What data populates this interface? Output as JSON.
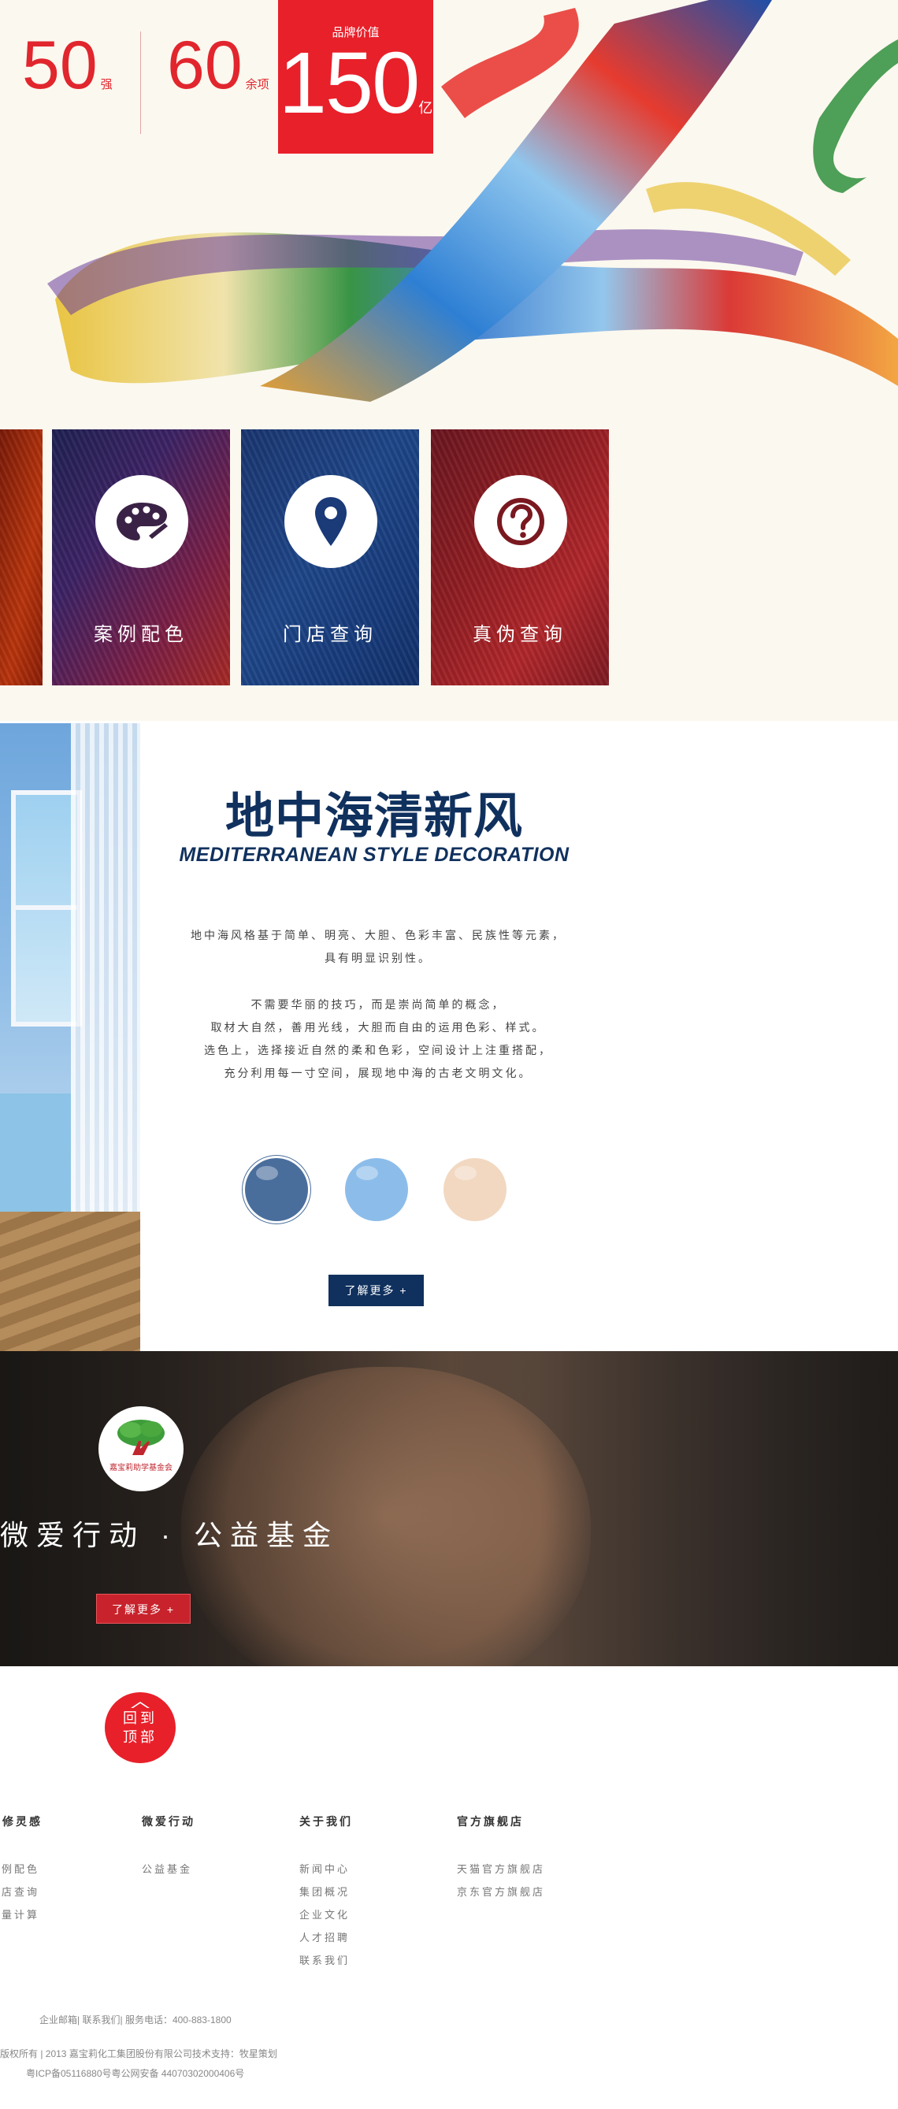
{
  "hero": {
    "stats": [
      {
        "value": "50",
        "unit": "强"
      },
      {
        "value": "60",
        "unit": "余项"
      }
    ],
    "brand_value": {
      "label": "品牌价值",
      "value": "150",
      "unit": "亿"
    },
    "colors": {
      "accent": "#e8202a"
    }
  },
  "cards": [
    {
      "label": "",
      "icon": "palette-icon"
    },
    {
      "label": "案例配色",
      "icon": "palette-icon"
    },
    {
      "label": "门店查询",
      "icon": "map-pin-icon"
    },
    {
      "label": "真伪查询",
      "icon": "question-icon"
    }
  ],
  "mediterranean": {
    "title": "地中海清新风",
    "subtitle": "MEDITERRANEAN STYLE DECORATION",
    "para1": [
      "地中海风格基于简单、明亮、大胆、色彩丰富、民族性等元素，",
      "具有明显识别性。"
    ],
    "para2": [
      "不需要华丽的技巧，而是崇尚简单的概念，",
      "取材大自然，善用光线，大胆而自由的运用色彩、样式。",
      "选色上，选择接近自然的柔和色彩，空间设计上注重搭配，",
      "充分利用每一寸空间，展现地中海的古老文明文化。"
    ],
    "swatch_colors": [
      "#4a6e9c",
      "#8cbdea",
      "#f2d8c1"
    ],
    "button": "了解更多 +"
  },
  "charity": {
    "logo_caption": "嘉宝莉助学基金会",
    "title": "微爱行动 · 公益基金",
    "button": "了解更多 +"
  },
  "footer": {
    "back_to_top": [
      "回到",
      "顶部"
    ],
    "columns": [
      {
        "heading": "装修灵感",
        "links": [
          "案例配色",
          "门店查询",
          "用量计算"
        ]
      },
      {
        "heading": "微爱行动",
        "links": [
          "公益基金"
        ]
      },
      {
        "heading": "关于我们",
        "links": [
          "新闻中心",
          "集团概况",
          "企业文化",
          "人才招聘",
          "联系我们"
        ]
      },
      {
        "heading": "官方旗舰店",
        "links": [
          "天猫官方旗舰店",
          "京东官方旗舰店"
        ]
      }
    ],
    "contact": {
      "email": "企业邮箱",
      "contact_us": "联系我们",
      "phone": "服务电话：400-883-1800"
    },
    "copyright": "版权所有 | 2013 嘉宝莉化工集团股份有限公司技术支持：牧星策划",
    "icp": "粤ICP备05116880号粤公网安备 44070302000406号"
  }
}
